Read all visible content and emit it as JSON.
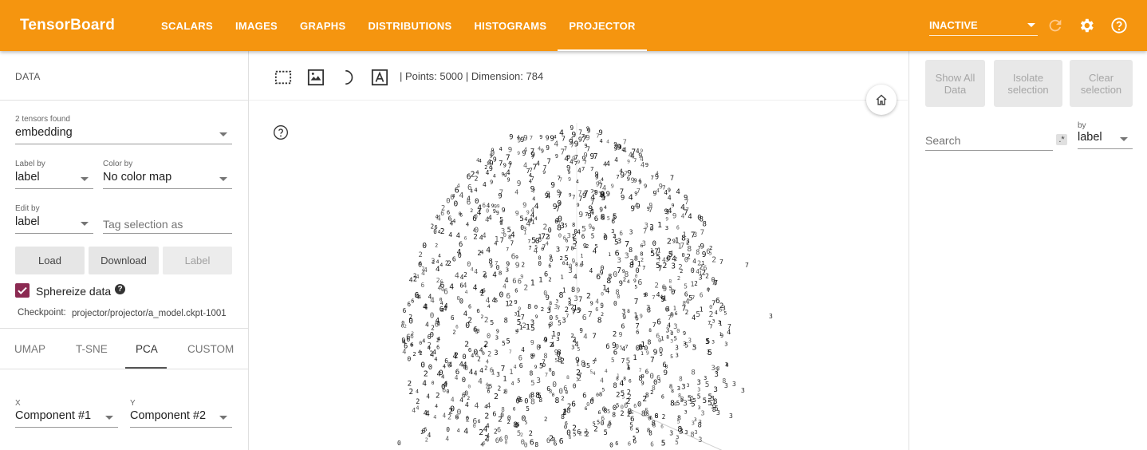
{
  "header": {
    "brand": "TensorBoard",
    "tabs": [
      {
        "label": "SCALARS"
      },
      {
        "label": "IMAGES"
      },
      {
        "label": "GRAPHS"
      },
      {
        "label": "DISTRIBUTIONS"
      },
      {
        "label": "HISTOGRAMS"
      },
      {
        "label": "PROJECTOR"
      }
    ],
    "active_tab": "PROJECTOR",
    "run_select": "INACTIVE",
    "accent_color": "#f5950f"
  },
  "data_panel": {
    "title": "DATA",
    "tensors_found": "2 tensors found",
    "tensor_value": "embedding",
    "label_by_label": "Label by",
    "label_by_value": "label",
    "color_by_label": "Color by",
    "color_by_value": "No color map",
    "edit_by_label": "Edit by",
    "edit_by_value": "label",
    "tag_placeholder": "Tag selection as",
    "buttons": {
      "load": "Load",
      "download": "Download",
      "label": "Label"
    },
    "sphereize_label": "Sphereize data",
    "sphereize_checked": true,
    "checkpoint_label": "Checkpoint:",
    "checkpoint_value": "projector/projector/a_model.ckpt-1001",
    "projection_tabs": [
      "UMAP",
      "T-SNE",
      "PCA",
      "CUSTOM"
    ],
    "active_projection": "PCA",
    "x_label": "X",
    "x_value": "Component #1",
    "y_label": "Y",
    "y_value": "Component #2"
  },
  "toolbar": {
    "icons": [
      "bounding-box-select-icon",
      "image-mode-icon",
      "night-mode-icon",
      "label-mode-icon"
    ],
    "points_info": "| Points: 5000 | Dimension: 784"
  },
  "inspector": {
    "show_all": "Show All Data",
    "isolate": "Isolate selection",
    "clear": "Clear selection",
    "search_placeholder": "Search",
    "regex_label": ".*",
    "by_label": "by",
    "by_value": "label"
  }
}
